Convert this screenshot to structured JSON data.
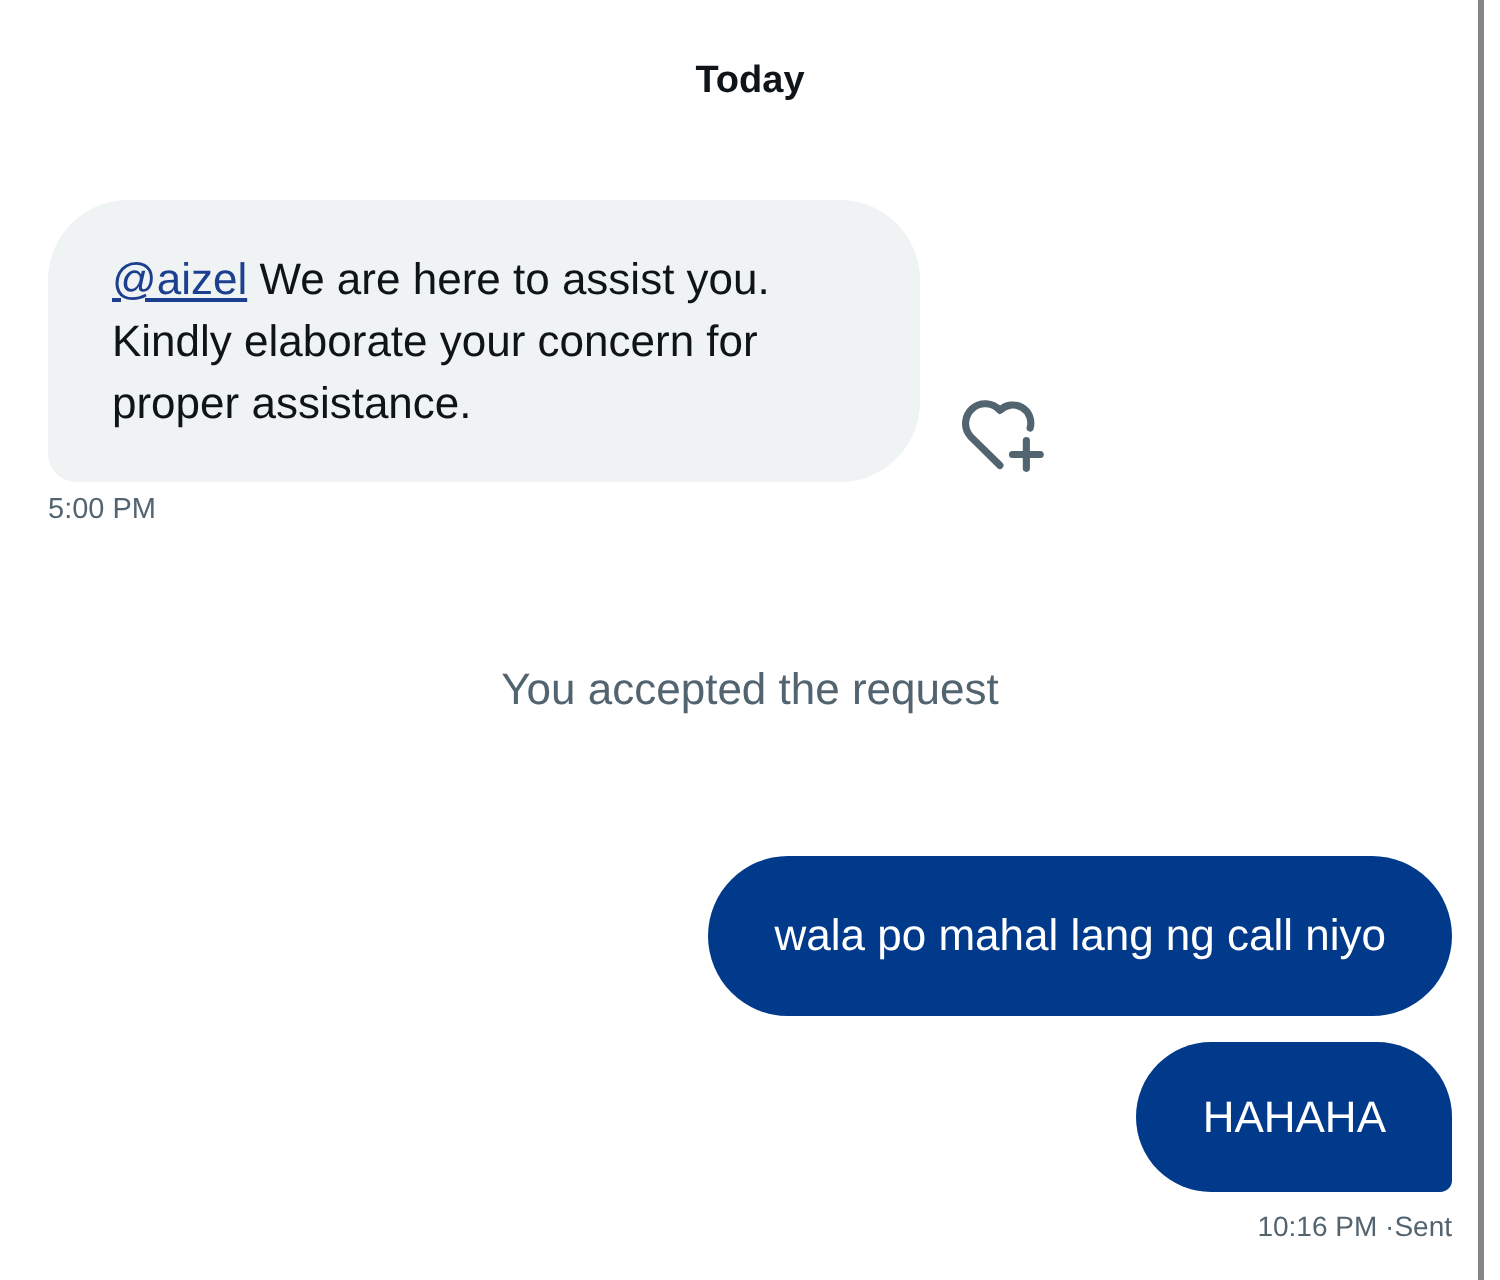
{
  "date_label": "Today",
  "received": [
    {
      "mention": "@aizel",
      "text": "We are here to assist you. Kindly elaborate your concern for proper assistance.",
      "time": "5:00 PM"
    }
  ],
  "notice": "You accepted the request",
  "sent": [
    {
      "text": "wala po mahal lang ng call niyo"
    },
    {
      "text": "HAHAHA"
    }
  ],
  "sent_status": "10:16 PM ·Sent"
}
